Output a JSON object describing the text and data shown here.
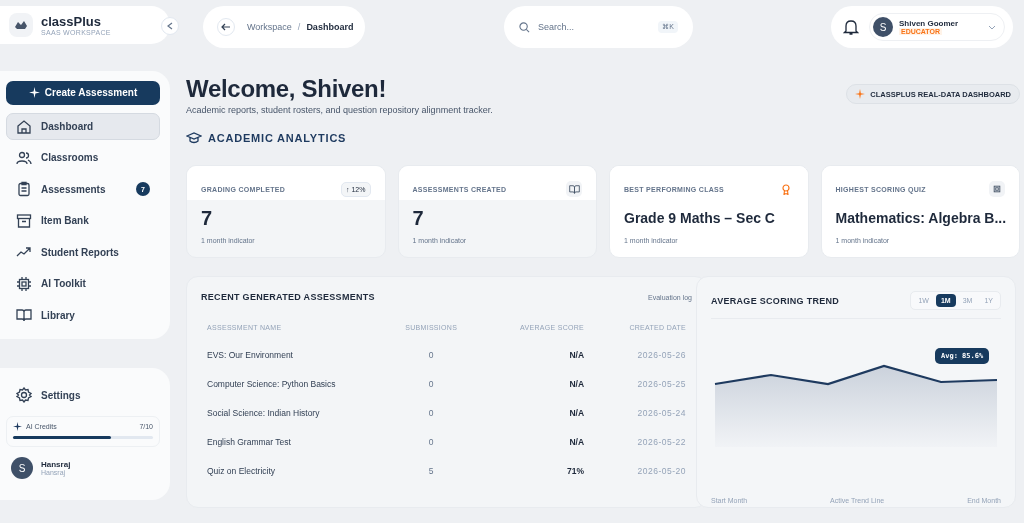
{
  "brand": {
    "name": "classPlus",
    "subtitle": "SAAS WORKSPACE"
  },
  "breadcrumb": {
    "parent": "Workspace",
    "separator": "/",
    "current": "Dashboard"
  },
  "search": {
    "placeholder": "Search...",
    "shortcut": "⌘K"
  },
  "user": {
    "initial": "S",
    "name": "Shiven Goomer",
    "role": "EDUCATOR"
  },
  "sidebar": {
    "create_button": "Create Assessment",
    "items": [
      {
        "label": "Dashboard",
        "selected": true
      },
      {
        "label": "Classrooms",
        "selected": false
      },
      {
        "label": "Assessments",
        "badge": "7",
        "selected": false
      },
      {
        "label": "Item Bank",
        "selected": false
      },
      {
        "label": "Student Reports",
        "selected": false
      },
      {
        "label": "AI Toolkit",
        "selected": false
      },
      {
        "label": "Library",
        "selected": false
      }
    ]
  },
  "settings": {
    "label": "Settings"
  },
  "credits": {
    "label": "AI Credits",
    "reading": "7/10",
    "level": 0.7
  },
  "account": {
    "initial": "S",
    "name": "Hansraj",
    "subtitle": "Hansraj"
  },
  "heading": "Welcome, Shiven!",
  "subheading": "Academic reports, student rosters, and question repository alignment tracker.",
  "dashboard_button": "CLASSPLUS REAL-DATA DASHBOARD",
  "section_title": "ACADEMIC ANALYTICS",
  "stats": [
    {
      "label": "GRADING COMPLETED",
      "value": "7",
      "note": "1 month indicator",
      "kind": "trend",
      "badge": "↑ 12%"
    },
    {
      "label": "ASSESSMENTS CREATED",
      "value": "7",
      "note": "1 month indicator",
      "kind": "book"
    },
    {
      "label": "BEST PERFORMING CLASS",
      "value": "Grade 9 Maths – Sec C",
      "note": "1 month indicator",
      "kind": "award"
    },
    {
      "label": "HIGHEST SCORING QUIZ",
      "value": "Mathematics: Algebra B...",
      "note": "1 month indicator",
      "kind": "chip"
    }
  ],
  "table": {
    "title": "RECENT GENERATED ASSESSMENTS",
    "link": "Evaluation log",
    "columns": [
      "ASSESSMENT NAME",
      "SUBMISSIONS",
      "AVERAGE SCORE",
      "CREATED DATE"
    ],
    "rows": [
      [
        "EVS: Our Environment",
        "0",
        "N/A",
        "2026-05-26"
      ],
      [
        "Computer Science: Python Basics",
        "0",
        "N/A",
        "2026-05-25"
      ],
      [
        "Social Science: Indian History",
        "0",
        "N/A",
        "2026-05-24"
      ],
      [
        "English Grammar Test",
        "0",
        "N/A",
        "2026-05-22"
      ],
      [
        "Quiz on Electricity",
        "5",
        "71%",
        "2026-05-20"
      ]
    ]
  },
  "trend": {
    "title": "AVERAGE SCORING TREND",
    "ranges": [
      {
        "label": "1W",
        "selected": false
      },
      {
        "label": "1M",
        "selected": true
      },
      {
        "label": "3M",
        "selected": false
      },
      {
        "label": "1Y",
        "selected": false
      }
    ],
    "tooltip": "Avg: 85.6%",
    "axis_labels": [
      "Start Month",
      "Active Trend Line",
      "End Month"
    ]
  }
}
